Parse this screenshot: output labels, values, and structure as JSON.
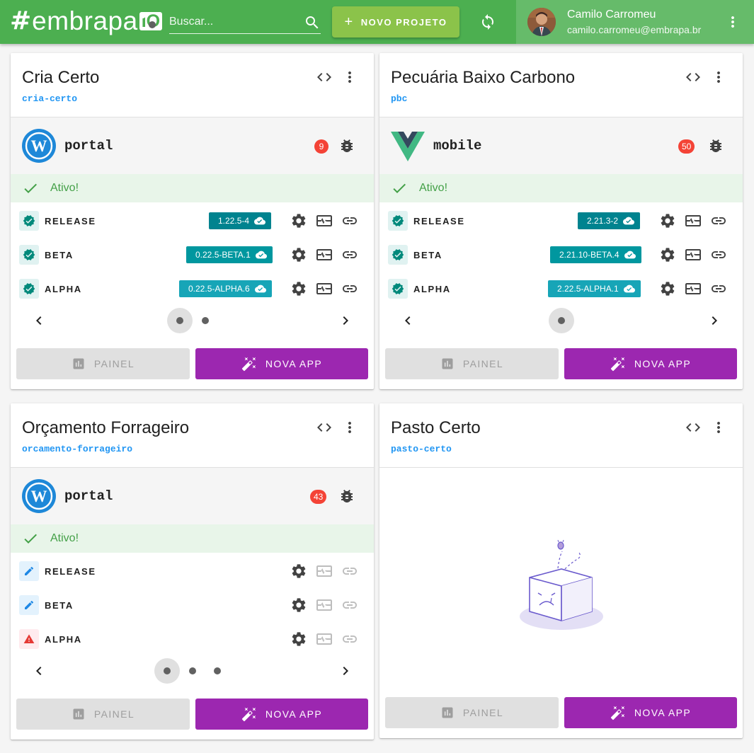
{
  "header": {
    "logo_hash": "#",
    "logo_word": "embrapa",
    "logo_io": "IO",
    "search_placeholder": "Buscar...",
    "new_project_label": "NOVO PROJETO",
    "user_name": "Camilo Carromeu",
    "user_email": "camilo.carromeu@embrapa.br"
  },
  "colors": {
    "appbar": "#4caf50",
    "accent_green": "#8bc34a",
    "purple": "#9c27b0",
    "release": "#00838f",
    "beta": "#00979f",
    "alpha": "#17a5b7",
    "badge": "#f44336"
  },
  "common": {
    "status_text": "Ativo!",
    "panel_label": "PAINEL",
    "new_app_label": "NOVA APP",
    "stage_release": "RELEASE",
    "stage_beta": "BETA",
    "stage_alpha": "ALPHA"
  },
  "projects": [
    {
      "title": "Cria Certo",
      "slug": "cria-certo",
      "app": {
        "name": "portal",
        "icon": "wordpress-logo",
        "bugs": "9"
      },
      "versions": {
        "release": "1.22.5-4",
        "beta": "0.22.5-BETA.1",
        "alpha": "0.22.5-ALPHA.6"
      },
      "pages": 2,
      "active_page": 1
    },
    {
      "title": "Pecuária Baixo Carbono",
      "slug": "pbc",
      "app": {
        "name": "mobile",
        "icon": "vue-logo",
        "bugs": "50"
      },
      "versions": {
        "release": "2.21.3-2",
        "beta": "2.21.10-BETA.4",
        "alpha": "2.22.5-ALPHA.1"
      },
      "pages": 1,
      "active_page": 1
    },
    {
      "title": "Orçamento Forrageiro",
      "slug": "orcamento-forrageiro",
      "app": {
        "name": "portal",
        "icon": "wordpress-logo",
        "bugs": "43"
      },
      "stage_icons": [
        "pencil-icon",
        "pencil-icon",
        "warning-icon"
      ],
      "pages": 3,
      "active_page": 1
    },
    {
      "title": "Pasto Certo",
      "slug": "pasto-certo",
      "empty_illustration": "empty-box-illustration"
    }
  ]
}
